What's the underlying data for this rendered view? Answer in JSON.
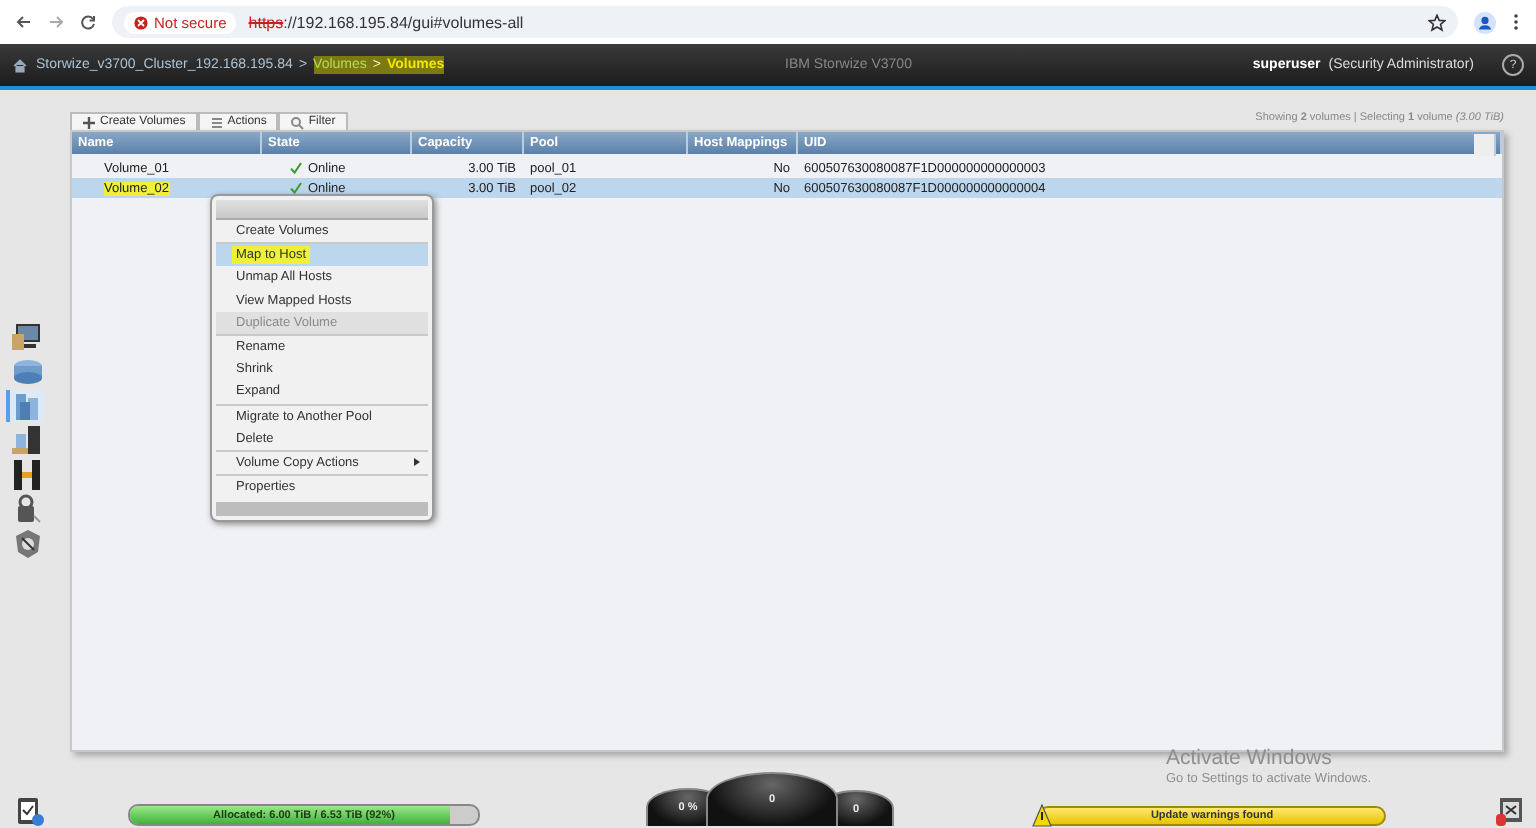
{
  "browser": {
    "security": "Not secure",
    "url_scheme": "https",
    "url_rest": "://192.168.195.84/gui#volumes-all"
  },
  "header": {
    "breadcrumbs": [
      {
        "label": "Storwize_v3700_Cluster_192.168.195.84",
        "highlighted": false,
        "current": false
      },
      {
        "separator": ">",
        "label": "Volumes",
        "highlighted": true,
        "current": false
      },
      {
        "separator": ">",
        "label": "Volumes",
        "highlighted": true,
        "current": true
      }
    ],
    "product": "IBM Storwize V3700",
    "user": "superuser",
    "role": "(Security Administrator)",
    "help": "?"
  },
  "sidebar": {
    "items": [
      {
        "kind": "monitor",
        "selected": false
      },
      {
        "kind": "pools",
        "selected": false
      },
      {
        "kind": "volumes",
        "selected": true
      },
      {
        "kind": "hosts",
        "selected": false
      },
      {
        "kind": "copy",
        "selected": false
      },
      {
        "kind": "access",
        "selected": false
      },
      {
        "kind": "settings",
        "selected": false
      }
    ]
  },
  "toolbar": [
    {
      "label": "Create Volumes",
      "kind": "plus"
    },
    {
      "label": "Actions",
      "kind": "list"
    },
    {
      "label": "Filter",
      "kind": "search"
    }
  ],
  "summary": "Showing **2** volumes | Selecting **1** volume *(3.00 TiB)*",
  "table": {
    "columns": [
      "Name",
      "State",
      "Capacity",
      "Pool",
      "Host Mappings",
      "UID"
    ],
    "rows": [
      {
        "name": "Volume_01",
        "name_highlighted": false,
        "state": "Online",
        "capacity": "3.00 TiB",
        "pool": "pool_01",
        "host_mappings": "No",
        "uid": "600507630080087F1D000000000000003",
        "selected": false
      },
      {
        "name": "Volume_02",
        "name_highlighted": true,
        "state": "Online",
        "capacity": "3.00 TiB",
        "pool": "pool_02",
        "host_mappings": "No",
        "uid": "600507630080087F1D000000000000004",
        "selected": true
      }
    ]
  },
  "context_menu": {
    "items": [
      {
        "label": "Create Volumes",
        "disabled": false,
        "selected": false,
        "highlighted": false,
        "divider_before": false,
        "has_submenu": false
      },
      {
        "label": "Map to Host",
        "disabled": false,
        "selected": true,
        "highlighted": true,
        "divider_before": true,
        "has_submenu": false
      },
      {
        "label": "Unmap All Hosts",
        "disabled": false,
        "selected": false,
        "highlighted": false,
        "divider_before": false,
        "has_submenu": false
      },
      {
        "label": "View Mapped Hosts",
        "disabled": false,
        "selected": false,
        "highlighted": false,
        "divider_before": false,
        "has_submenu": false
      },
      {
        "label": "Duplicate Volume",
        "disabled": true,
        "selected": false,
        "highlighted": false,
        "divider_before": false,
        "has_submenu": false
      },
      {
        "label": "Rename",
        "disabled": false,
        "selected": false,
        "highlighted": false,
        "divider_before": true,
        "has_submenu": false
      },
      {
        "label": "Shrink",
        "disabled": false,
        "selected": false,
        "highlighted": false,
        "divider_before": false,
        "has_submenu": false
      },
      {
        "label": "Expand",
        "disabled": false,
        "selected": false,
        "highlighted": false,
        "divider_before": false,
        "has_submenu": false
      },
      {
        "label": "Migrate to Another Pool",
        "disabled": false,
        "selected": false,
        "highlighted": false,
        "divider_before": true,
        "has_submenu": false
      },
      {
        "label": "Delete",
        "disabled": false,
        "selected": false,
        "highlighted": false,
        "divider_before": false,
        "has_submenu": false
      },
      {
        "label": "Volume Copy Actions",
        "disabled": false,
        "selected": false,
        "highlighted": false,
        "divider_before": true,
        "has_submenu": true
      },
      {
        "label": "Properties",
        "disabled": false,
        "selected": false,
        "highlighted": false,
        "divider_before": true,
        "has_submenu": false
      }
    ]
  },
  "status_bar": {
    "allocation": {
      "text": "Allocated: 6.00 TiB / 6.53 TiB (92%)",
      "level": 0.92
    },
    "gauges": [
      {
        "reading": "0 %"
      },
      {
        "reading": "0"
      },
      {
        "reading": "0"
      }
    ],
    "warning": {
      "text": "Update warnings found"
    }
  },
  "os_notice": {
    "title": "Activate Windows",
    "subtitle": "Go to Settings to activate Windows."
  }
}
